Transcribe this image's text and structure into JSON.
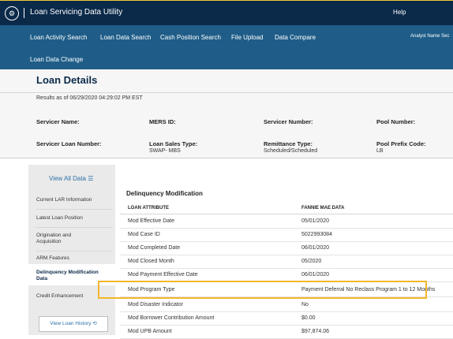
{
  "app": {
    "title": "Loan Servicing Data Utility",
    "logo_glyph": "⚙",
    "help": "Help"
  },
  "nav": {
    "items": [
      "Loan Activity Search",
      "Loan Data Search",
      "Cash Position Search",
      "File Upload",
      "Data Compare"
    ],
    "second_row_item": "Loan Data Change",
    "analyst": "Analyst Name Sec"
  },
  "page": {
    "title": "Loan Details",
    "results": "Results as of 06/29/2020 04:29:02 PM EST",
    "fields": {
      "servicer_name_label": "Servicer Name:",
      "mers_id_label": "MERS ID:",
      "servicer_number_label": "Servicer Number:",
      "pool_number_label": "Pool Number:",
      "servicer_loan_number_label": "Servicer Loan Number:",
      "loan_sales_type_label": "Loan Sales Type:",
      "loan_sales_type_value": "SWAP- MBS",
      "remittance_type_label": "Remittance Type:",
      "remittance_type_value": "Scheduled/Scheduled",
      "pool_prefix_code_label": "Pool Prefix Code:",
      "pool_prefix_code_value": "LB"
    }
  },
  "sidebar": {
    "view_all": "View All Data ☰",
    "items": [
      "Current LAR Information",
      "Latest Loan Position",
      "Origination and Acquisition",
      "ARM Features",
      "Delinquency Modification Data",
      "Credit Enhancement"
    ],
    "active_index": 4,
    "history_button": "View Loan History ⟲"
  },
  "section": {
    "title": "Delinquency Modification",
    "columns": [
      "LOAN ATTRIBUTE",
      "FANNIE MAE DATA"
    ],
    "rows": [
      [
        "Mod Effective Date",
        "05/01/2020"
      ],
      [
        "Mod Case ID",
        "5022993084"
      ],
      [
        "Mod Completed Date",
        "06/01/2020"
      ],
      [
        "Mod Closed Month",
        "05/2020"
      ],
      [
        "Mod Payment Effective Date",
        "06/01/2020"
      ],
      [
        "Mod Program Type",
        "Payment Deferral No Reclass Program 1 to 12 Months"
      ],
      [
        "Mod Disaster Indicator",
        "No"
      ],
      [
        "Mod Borrower Contribution Amount",
        "$0.00"
      ],
      [
        "Mod UPB Amount",
        "$97,874.06"
      ]
    ],
    "highlighted_row_index": 5
  },
  "colors": {
    "topbar": "#0b2a4a",
    "navbar": "#1f5d88",
    "highlight": "#f3b72b",
    "link": "#2a70a8"
  }
}
